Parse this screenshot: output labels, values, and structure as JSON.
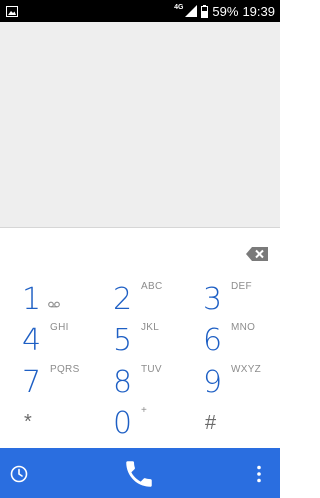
{
  "statusbar": {
    "network_label": "4G",
    "battery_text": "59%",
    "time": "19:39"
  },
  "keypad": {
    "keys": [
      {
        "digit": "1",
        "letters": ""
      },
      {
        "digit": "2",
        "letters": "ABC"
      },
      {
        "digit": "3",
        "letters": "DEF"
      },
      {
        "digit": "4",
        "letters": "GHI"
      },
      {
        "digit": "5",
        "letters": "JKL"
      },
      {
        "digit": "6",
        "letters": "MNO"
      },
      {
        "digit": "7",
        "letters": "PQRS"
      },
      {
        "digit": "8",
        "letters": "TUV"
      },
      {
        "digit": "9",
        "letters": "WXYZ"
      },
      {
        "digit": "*",
        "letters": ""
      },
      {
        "digit": "0",
        "letters": "+"
      },
      {
        "digit": "#",
        "letters": ""
      }
    ]
  },
  "icons": {
    "image_notification": "image-icon",
    "signal": "signal-icon",
    "battery": "battery-icon",
    "voicemail": "voicemail-icon",
    "backspace": "backspace-icon",
    "history": "clock-icon",
    "call": "phone-icon",
    "menu": "more-vert-icon"
  },
  "colors": {
    "accent": "#2a6ee0",
    "digit": "#1e5fc4"
  }
}
